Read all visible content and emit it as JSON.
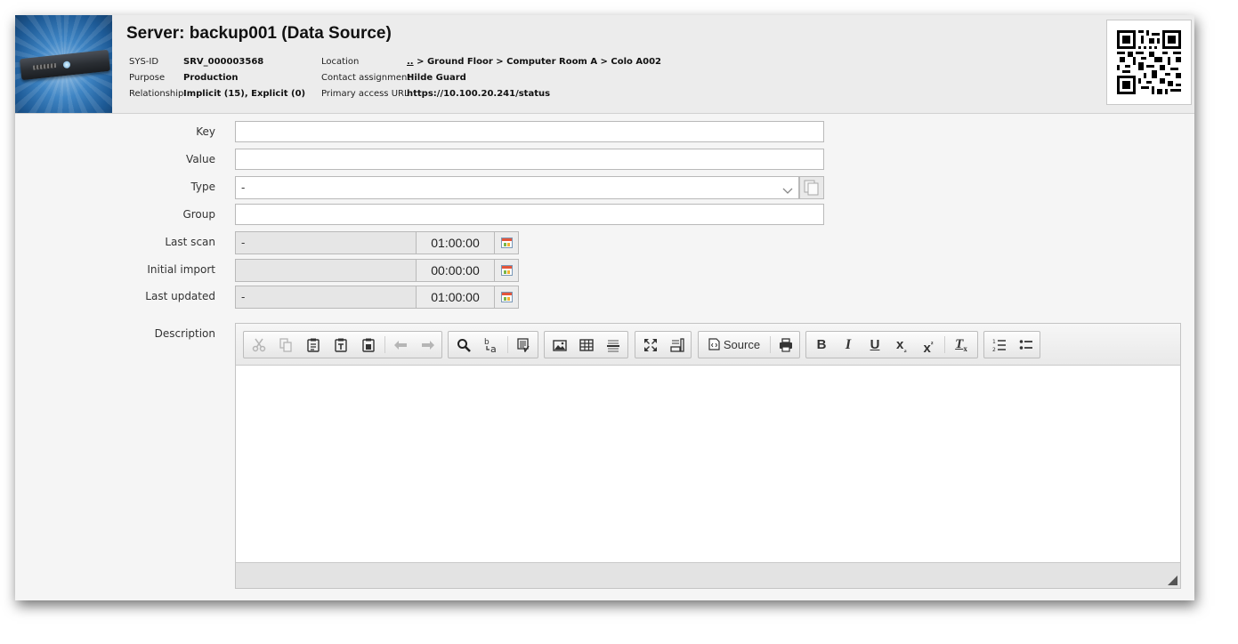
{
  "header": {
    "title": "Server: backup001 (Data Source)",
    "fields": {
      "sys_id_label": "SYS-ID",
      "sys_id_value": "SRV_000003568",
      "purpose_label": "Purpose",
      "purpose_value": "Production",
      "relationship_label": "Relationship",
      "relationship_value": "Implicit (15), Explicit (0)",
      "location_label": "Location",
      "location_link": "..",
      "location_value": " > Ground Floor > Computer Room A > Colo A002",
      "contact_label": "Contact assignment",
      "contact_value": "Hilde Guard",
      "url_label": "Primary access URL",
      "url_value": "https://10.100.20.241/status"
    }
  },
  "form": {
    "key_label": "Key",
    "key_value": "",
    "value_label": "Value",
    "value_value": "",
    "type_label": "Type",
    "type_value": "-",
    "group_label": "Group",
    "group_value": "",
    "last_scan_label": "Last scan",
    "last_scan_date": "-",
    "last_scan_time": "01:00:00",
    "initial_import_label": "Initial import",
    "initial_import_date": "",
    "initial_import_time": "00:00:00",
    "last_updated_label": "Last updated",
    "last_updated_date": "-",
    "last_updated_time": "01:00:00",
    "description_label": "Description"
  },
  "editor": {
    "source_label": "Source",
    "content": ""
  },
  "colors": {
    "header_bg": "#ececec",
    "page_bg": "#f5f5f5"
  }
}
